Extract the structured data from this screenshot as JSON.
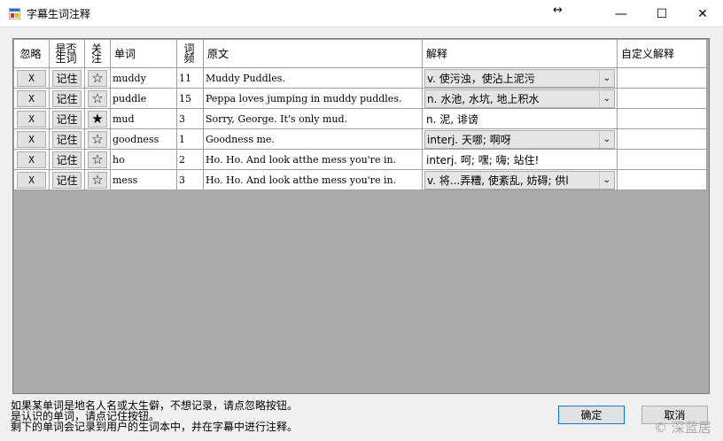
{
  "window": {
    "title": "字幕生词注释",
    "minimize_glyph": "—",
    "maximize_glyph": "☐",
    "close_glyph": "✕",
    "resize_glyph": "↔"
  },
  "grid": {
    "headers": {
      "ignore": "忽略",
      "is_new_1": "是否",
      "is_new_2": "生词",
      "follow_1": "关",
      "follow_2": "注",
      "word": "单词",
      "freq_1": "词",
      "freq_2": "频",
      "original": "原文",
      "explanation": "解释",
      "custom": "自定义解释"
    },
    "rows": [
      {
        "ignore": "X",
        "remember": "记住",
        "star": "☆",
        "word": "muddy",
        "freq": "11",
        "original": "Muddy Puddles.",
        "explanation": "v.   使污浊，使沾上泥污",
        "combo": true,
        "custom": ""
      },
      {
        "ignore": "X",
        "remember": "记住",
        "star": "☆",
        "word": "puddle",
        "freq": "15",
        "original": "Peppa loves jumping in muddy puddles.",
        "explanation": "n.   水池, 水坑, 地上积水",
        "combo": true,
        "custom": ""
      },
      {
        "ignore": "X",
        "remember": "记住",
        "star": "★",
        "word": "mud",
        "freq": "3",
        "original": "Sorry, George. It's only mud.",
        "explanation": "n.   泥, 诽谤",
        "combo": false,
        "custom": ""
      },
      {
        "ignore": "X",
        "remember": "记住",
        "star": "☆",
        "word": "goodness",
        "freq": "1",
        "original": "Goodness me.",
        "explanation": "interj.   天哪; 啊呀",
        "combo": true,
        "custom": ""
      },
      {
        "ignore": "X",
        "remember": "记住",
        "star": "☆",
        "word": "ho",
        "freq": "2",
        "original": "Ho. Ho. And look atthe mess you're in.",
        "explanation": "interj.   呵; 嘿; 嗨; 站住!",
        "combo": false,
        "custom": ""
      },
      {
        "ignore": "X",
        "remember": "记住",
        "star": "☆",
        "word": "mess",
        "freq": "3",
        "original": "Ho. Ho. And look atthe mess you're in.",
        "explanation": "v.   将...弄糟, 使紊乱, 妨碍; 供l",
        "combo": true,
        "custom": ""
      }
    ],
    "combo_arrow": "⌄"
  },
  "footer": {
    "line1": "如果某单词是地名人名或太生僻，不想记录，请点忽略按钮。",
    "line2": "是认识的单词，请点记住按钮。",
    "line3": "剩下的单词会记录到用户的生词本中，并在字幕中进行注释。",
    "ok_label": "确定",
    "cancel_label": "取消"
  },
  "watermark": "© 深蓝居"
}
